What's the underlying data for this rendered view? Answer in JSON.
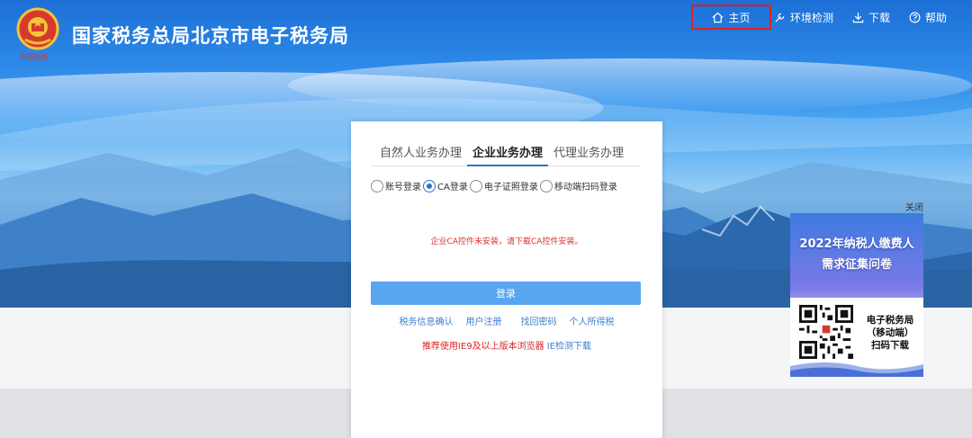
{
  "header": {
    "emblem_caption": "中国税务",
    "title": "国家税务总局北京市电子税务局"
  },
  "topnav": {
    "items": [
      {
        "label": "主页",
        "icon": "home-icon"
      },
      {
        "label": "环境检测",
        "icon": "wrench-icon"
      },
      {
        "label": "下载",
        "icon": "download-icon"
      },
      {
        "label": "帮助",
        "icon": "help-icon"
      }
    ]
  },
  "login": {
    "tabs": [
      "自然人业务办理",
      "企业业务办理",
      "代理业务办理"
    ],
    "active_tab": "企业业务办理",
    "methods": [
      "账号登录",
      "CA登录",
      "电子证照登录",
      "移动端扫码登录"
    ],
    "selected_method": "CA登录",
    "warning_prefix": "企业CA控件未安装，请",
    "warning_link": "下载CA控件安装",
    "warning_suffix": "。",
    "button": "登录",
    "links": [
      "税务信息确认",
      "用户注册",
      "找回密码",
      "个人所得税"
    ],
    "browser_note": "推荐使用IE9及以上版本浏览器",
    "ie_check_link": "IE检测下载"
  },
  "promo": {
    "close": "关闭",
    "title_line1": "2022年纳税人缴费人",
    "title_line2": "需求征集问卷",
    "qr_line1": "电子税务局",
    "qr_line2": "（移动端）",
    "qr_line3": "扫码下载"
  },
  "colors": {
    "accent": "#2e73c9",
    "button": "#5aa5ef",
    "link": "#3c7fd0",
    "warning": "#e02f2f",
    "highlight_border": "#e02020"
  }
}
